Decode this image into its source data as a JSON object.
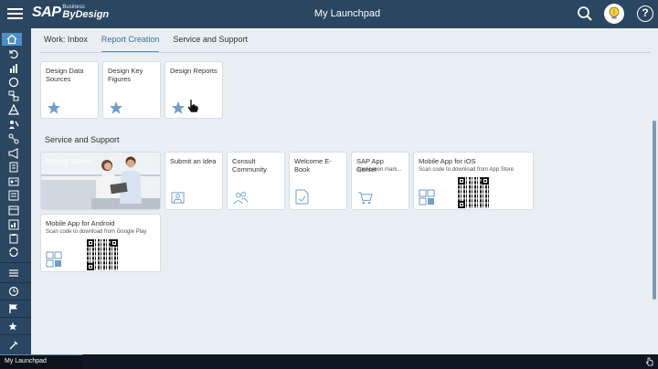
{
  "header": {
    "title": "My Launchpad",
    "logo_sap": "SAP",
    "logo_business": "Business",
    "logo_bydesign": "ByDesign"
  },
  "tabs": [
    {
      "label": "Work: Inbox"
    },
    {
      "label": "Report Creation"
    },
    {
      "label": "Service and Support"
    }
  ],
  "report_tiles": [
    {
      "title": "Design Data Sources"
    },
    {
      "title": "Design Key Figures"
    },
    {
      "title": "Design Reports"
    }
  ],
  "service_section_title": "Service and Support",
  "service_tiles": [
    {
      "title": "Getting Started"
    },
    {
      "title": "Submit an Idea"
    },
    {
      "title": "Consult Community"
    },
    {
      "title": "Welcome E-Book"
    },
    {
      "title": "SAP App Center",
      "subtitle": "Application mark..."
    },
    {
      "title": "Mobile App for iOS",
      "subtitle": "Scan code to download from App Store"
    },
    {
      "title": "Mobile App for Android",
      "subtitle": "Scan code to download from Google Play"
    }
  ],
  "bottom_bar": {
    "tab_label": "My Launchpad"
  },
  "colors": {
    "header": "#2a4660",
    "accent": "#4f8fc6",
    "background": "#e9eef3",
    "star": "#6f9ec8"
  }
}
